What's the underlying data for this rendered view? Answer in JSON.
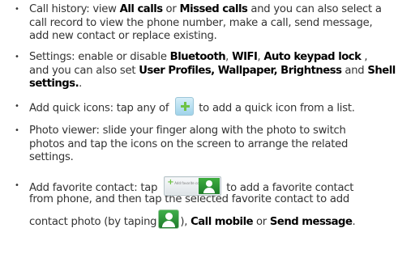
{
  "bullet_glyph": "•",
  "items": {
    "call_history": {
      "l1_a": "Call history: view ",
      "l1_k1": "All calls",
      "l1_b": " or ",
      "l1_k2": "Missed calls",
      "l1_c": " and you can also select a",
      "l2": "call record to view the phone number, make a call, send message,",
      "l3": "add new contact or replace existing."
    },
    "settings": {
      "l1_a": "Settings: enable or disable ",
      "l1_k1": "Bluetooth",
      "l1_b": ", ",
      "l1_k2": "WIFI",
      "l1_c": ", ",
      "l1_k3": "Auto keypad lock",
      "l1_d": " ,",
      "l2_a": "and you can also set ",
      "l2_k1": "User Profiles, Wallpaper, Brightness",
      "l2_b": " and ",
      "l2_k2": "Shell",
      "l3_k": "settings.",
      "l3_tail": "."
    },
    "quick_icons": {
      "l1_a": "Add quick icons: tap any of",
      "l1_icon": "add-icon",
      "l1_b": "to add a quick icon from a list."
    },
    "photo_viewer": {
      "l1": "Photo viewer: slide your finger along with the photo to switch",
      "l2": "photos and tap the icons on the screen to arrange the related",
      "l3": "settings."
    },
    "favorite_contact": {
      "l1_a": "Add favorite contact: tap",
      "l1_icon": "add-favorite-contact-widget-icon",
      "widget_text": "Add favorite contact",
      "l1_b": "to add a favorite contact",
      "l2": "from phone, and then tap the selected favorite contact to add",
      "l3_a": "contact photo (by taping",
      "l3_icon": "contact-photo-icon",
      "l3_b": "), ",
      "l3_k1": "Call mobile",
      "l3_c": " or ",
      "l3_k2": "Send message",
      "l3_d": "."
    }
  }
}
